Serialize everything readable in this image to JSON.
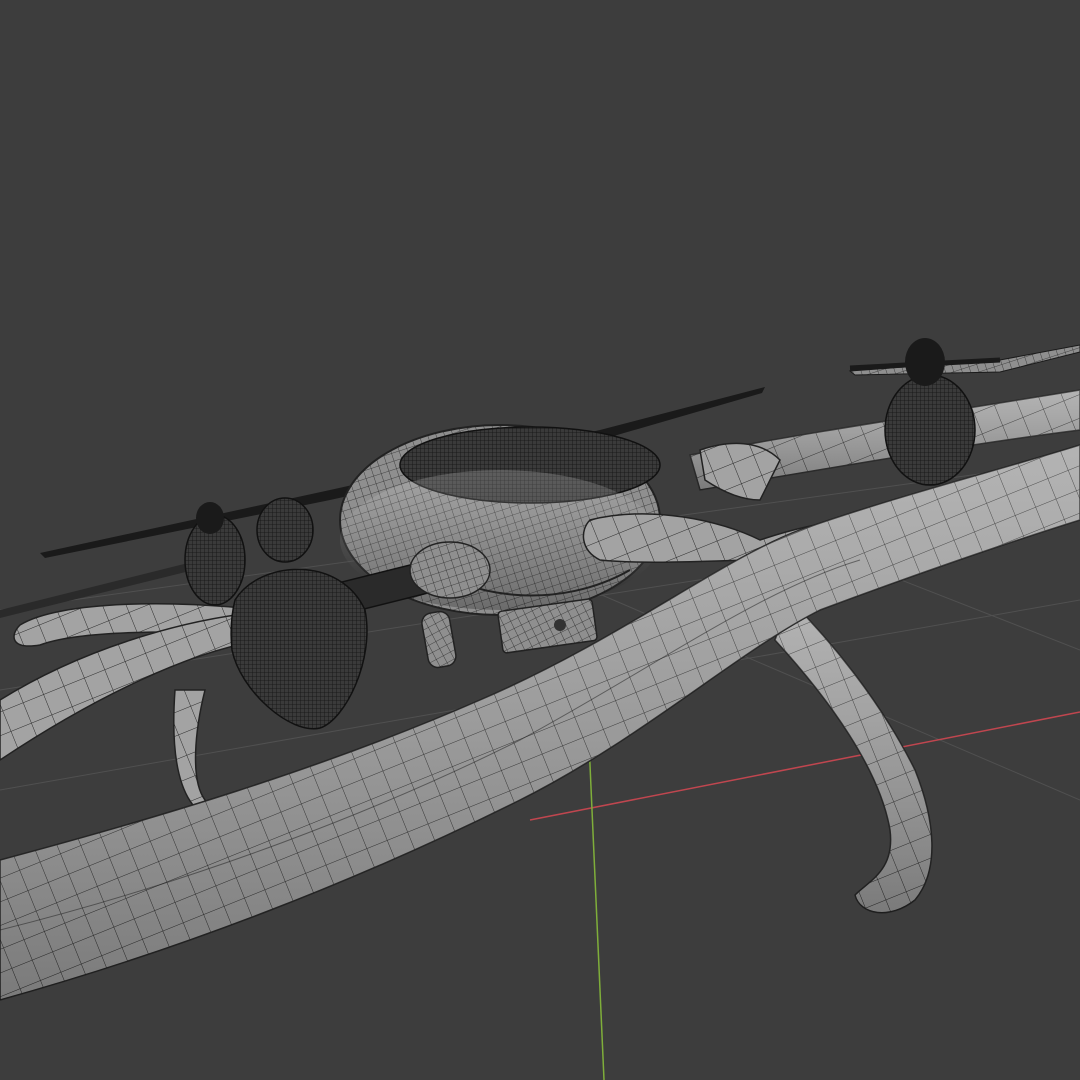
{
  "viewport": {
    "background_color": "#3d3d3d",
    "shading": "wireframe-over-solid",
    "grid_floor": true,
    "axes": {
      "x_axis_color": "#c0464f",
      "y_axis_color": "#7fae3a"
    }
  },
  "model": {
    "object": "quadcopter-drone",
    "mesh_color": "#9a9a9a",
    "wire_color": "#1e1e1e",
    "propeller_count": 4
  }
}
